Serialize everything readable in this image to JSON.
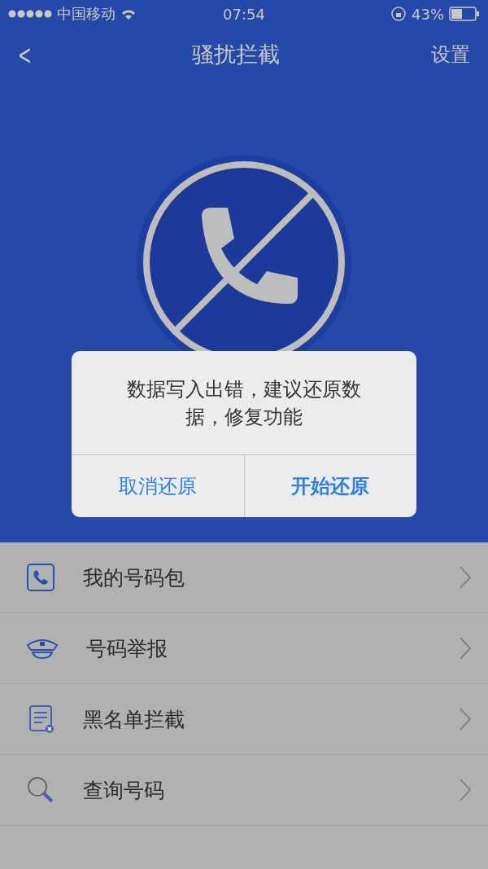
{
  "status_bar": {
    "carrier": "中国移动",
    "time": "07:54",
    "battery": "43%"
  },
  "nav": {
    "back": "<",
    "title": "骚扰拦截",
    "action": "设置"
  },
  "menu": [
    {
      "kind": "phone",
      "label": "我的号码包"
    },
    {
      "kind": "cap",
      "label": "号码举报"
    },
    {
      "kind": "list",
      "label": "黑名单拦截"
    },
    {
      "kind": "search",
      "label": "查询号码"
    }
  ],
  "dialog": {
    "message": "数据写入出错，建议还原数据，修复功能",
    "buttons": [
      "取消还原",
      "开始还原"
    ]
  }
}
